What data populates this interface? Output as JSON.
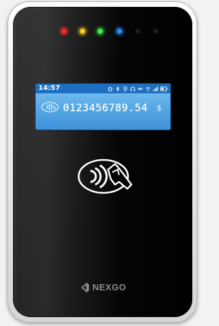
{
  "device": {
    "brand": "NEXGO"
  },
  "lcd": {
    "time": "14:57",
    "status_icons": [
      "home-icon",
      "bluetooth-icon",
      "location-icon",
      "headphones-icon",
      "volume-icon",
      "wifi-icon",
      "signal-icon",
      "battery-icon"
    ],
    "amount": "0123456789.54",
    "currency": "$"
  },
  "leds": [
    {
      "name": "red",
      "color": "#ff2a2a",
      "on": true
    },
    {
      "name": "yellow",
      "color": "#ffd21a",
      "on": true
    },
    {
      "name": "green",
      "color": "#3cf24a",
      "on": true
    },
    {
      "name": "blue",
      "color": "#2a8dff",
      "on": true
    },
    {
      "name": "off-1",
      "color": "#1b1b1b",
      "on": false
    },
    {
      "name": "off-2",
      "color": "#1b1b1b",
      "on": false
    }
  ],
  "colors": {
    "lcd_background": "#58a9e6",
    "lcd_status_bar": "#1f6fc1",
    "body": "#000000",
    "bezel": "#e6e6e6"
  }
}
